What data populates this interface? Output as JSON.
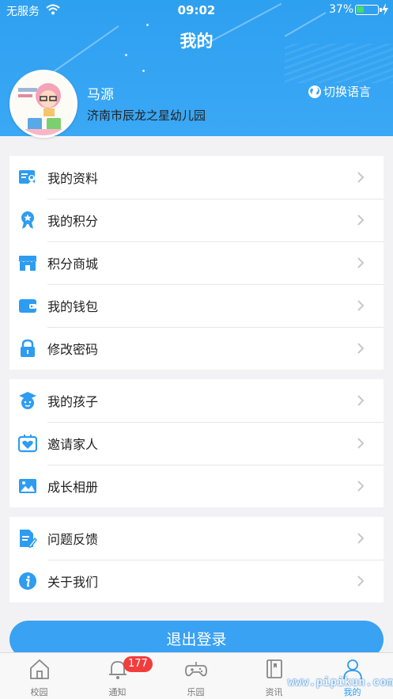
{
  "status_bar": {
    "carrier": "无服务",
    "time": "09:02",
    "battery": "37%"
  },
  "header": {
    "title": "我的"
  },
  "profile": {
    "name": "马源",
    "school": "济南市辰龙之星幼儿园",
    "language_switch": "切换语言"
  },
  "menu_groups": [
    [
      {
        "label": "我的资料",
        "icon": "profile-card-icon"
      },
      {
        "label": "我的积分",
        "icon": "medal-icon"
      },
      {
        "label": "积分商城",
        "icon": "store-icon"
      },
      {
        "label": "我的钱包",
        "icon": "wallet-icon"
      },
      {
        "label": "修改密码",
        "icon": "lock-icon"
      }
    ],
    [
      {
        "label": "我的孩子",
        "icon": "child-graduate-icon"
      },
      {
        "label": "邀请家人",
        "icon": "invite-heart-icon"
      },
      {
        "label": "成长相册",
        "icon": "photo-album-icon"
      }
    ],
    [
      {
        "label": "问题反馈",
        "icon": "feedback-doc-icon"
      },
      {
        "label": "关于我们",
        "icon": "info-icon"
      }
    ]
  ],
  "logout_label": "退出登录",
  "tabbar": {
    "tabs": [
      {
        "label": "校园",
        "icon": "home-icon"
      },
      {
        "label": "通知",
        "icon": "bell-icon",
        "badge": "177"
      },
      {
        "label": "乐园",
        "icon": "gamepad-icon"
      },
      {
        "label": "资讯",
        "icon": "book-icon"
      },
      {
        "label": "我的",
        "icon": "person-icon",
        "active": true
      }
    ]
  },
  "watermark": "www.pipikun.com",
  "colors": {
    "primary": "#3aa2f3",
    "badge": "#f23d3d",
    "icon_blue": "#2e9cf0"
  }
}
